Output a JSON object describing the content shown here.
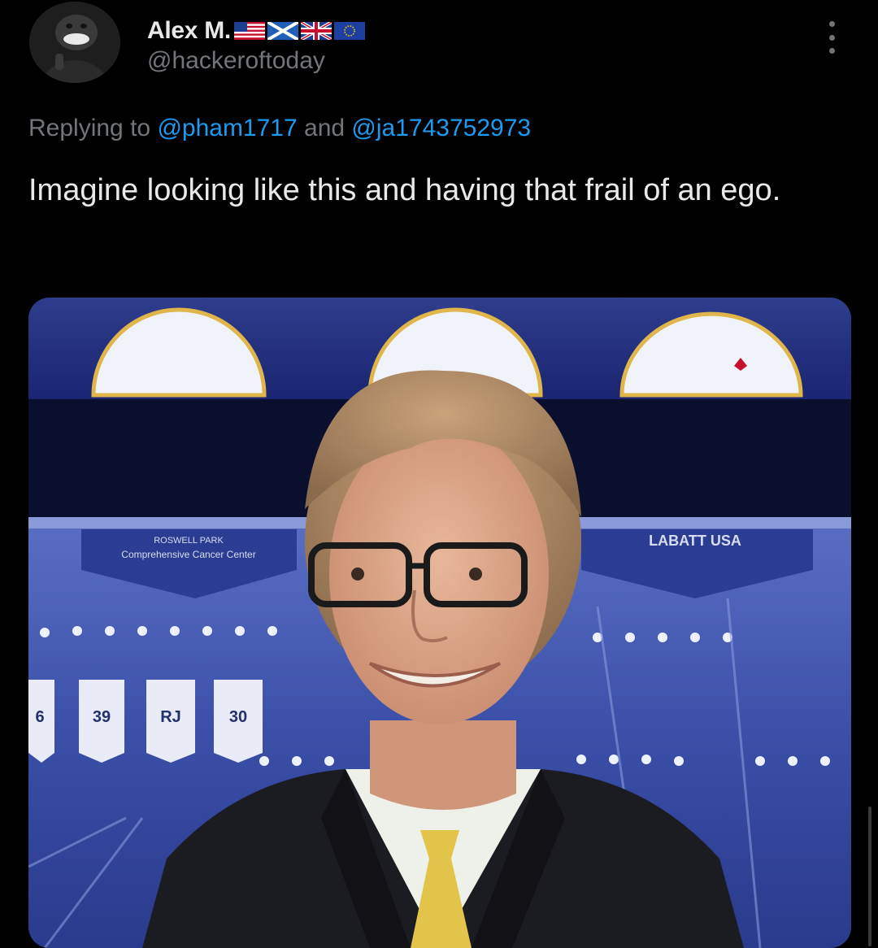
{
  "author": {
    "display_name": "Alex M.",
    "handle": "@hackeroftoday",
    "flags": [
      "us-flag-icon",
      "scotland-flag-icon",
      "uk-flag-icon",
      "eu-flag-icon"
    ]
  },
  "reply": {
    "prefix": "Replying to ",
    "mention_1": "@pham1717",
    "connector": " and ",
    "mention_2": "@ja1743752973"
  },
  "tweet": {
    "text": "Imagine looking like this and having that frail of an ego."
  },
  "media": {
    "banner_left": "Comprehensive Cancer Center",
    "banner_left_top": "ROSWELL PARK",
    "banner_right": "LABATT USA",
    "jerseys": [
      "6",
      "39",
      "RJ",
      "30"
    ]
  },
  "colors": {
    "background": "#000000",
    "text_primary": "#e7e9ea",
    "text_secondary": "#71767b",
    "link": "#1d9bf0"
  }
}
